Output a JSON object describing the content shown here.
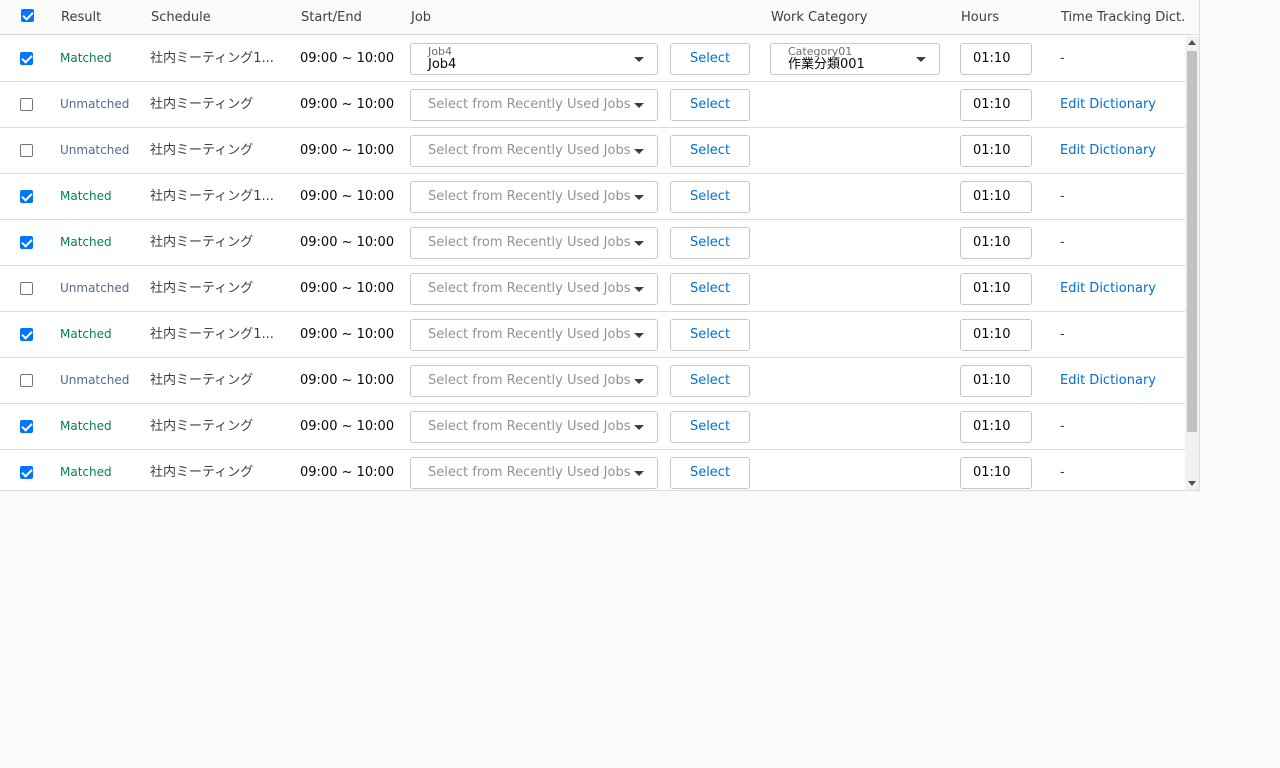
{
  "header": {
    "select_all_checked": true,
    "result": "Result",
    "schedule": "Schedule",
    "start_end": "Start/End",
    "job": "Job",
    "work_category": "Work Category",
    "hours": "Hours",
    "dict": "Time Tracking Dict."
  },
  "rows": [
    {
      "checked": true,
      "result": "Matched",
      "schedule": "社内ミーティング1...",
      "time": "09:00 ~ 10:00",
      "job_label": "Job4",
      "job_value": "Job4",
      "job_placeholder": "",
      "select": "Select",
      "category_label": "Category01",
      "category_value": "作業分類001",
      "hours": "01:10",
      "dict": "-"
    },
    {
      "checked": false,
      "result": "Unmatched",
      "schedule": "社内ミーティング",
      "time": "09:00 ~ 10:00",
      "job_label": "",
      "job_value": "",
      "job_placeholder": "Select from Recently Used Jobs",
      "select": "Select",
      "category_label": "",
      "category_value": "",
      "hours": "01:10",
      "dict": "Edit Dictionary"
    },
    {
      "checked": false,
      "result": "Unmatched",
      "schedule": "社内ミーティング",
      "time": "09:00 ~ 10:00",
      "job_label": "",
      "job_value": "",
      "job_placeholder": "Select from Recently Used Jobs",
      "select": "Select",
      "category_label": "",
      "category_value": "",
      "hours": "01:10",
      "dict": "Edit Dictionary"
    },
    {
      "checked": true,
      "result": "Matched",
      "schedule": "社内ミーティング1...",
      "time": "09:00 ~ 10:00",
      "job_label": "",
      "job_value": "",
      "job_placeholder": "Select from Recently Used Jobs",
      "select": "Select",
      "category_label": "",
      "category_value": "",
      "hours": "01:10",
      "dict": "-"
    },
    {
      "checked": true,
      "result": "Matched",
      "schedule": "社内ミーティング",
      "time": "09:00 ~ 10:00",
      "job_label": "",
      "job_value": "",
      "job_placeholder": "Select from Recently Used Jobs",
      "select": "Select",
      "category_label": "",
      "category_value": "",
      "hours": "01:10",
      "dict": "-"
    },
    {
      "checked": false,
      "result": "Unmatched",
      "schedule": "社内ミーティング",
      "time": "09:00 ~ 10:00",
      "job_label": "",
      "job_value": "",
      "job_placeholder": "Select from Recently Used Jobs",
      "select": "Select",
      "category_label": "",
      "category_value": "",
      "hours": "01:10",
      "dict": "Edit Dictionary"
    },
    {
      "checked": true,
      "result": "Matched",
      "schedule": "社内ミーティング1...",
      "time": "09:00 ~ 10:00",
      "job_label": "",
      "job_value": "",
      "job_placeholder": "Select from Recently Used Jobs",
      "select": "Select",
      "category_label": "",
      "category_value": "",
      "hours": "01:10",
      "dict": "-"
    },
    {
      "checked": false,
      "result": "Unmatched",
      "schedule": "社内ミーティング",
      "time": "09:00 ~ 10:00",
      "job_label": "",
      "job_value": "",
      "job_placeholder": "Select from Recently Used Jobs",
      "select": "Select",
      "category_label": "",
      "category_value": "",
      "hours": "01:10",
      "dict": "Edit Dictionary"
    },
    {
      "checked": true,
      "result": "Matched",
      "schedule": "社内ミーティング",
      "time": "09:00 ~ 10:00",
      "job_label": "",
      "job_value": "",
      "job_placeholder": "Select from Recently Used Jobs",
      "select": "Select",
      "category_label": "",
      "category_value": "",
      "hours": "01:10",
      "dict": "-"
    },
    {
      "checked": true,
      "result": "Matched",
      "schedule": "社内ミーティング",
      "time": "09:00 ~ 10:00",
      "job_label": "",
      "job_value": "",
      "job_placeholder": "Select from Recently Used Jobs",
      "select": "Select",
      "category_label": "",
      "category_value": "",
      "hours": "01:10",
      "dict": "-"
    }
  ],
  "colors": {
    "matched": "#04844b",
    "unmatched": "#54698d",
    "link": "#0070d2",
    "checkbox_checked": "#0075ff"
  }
}
